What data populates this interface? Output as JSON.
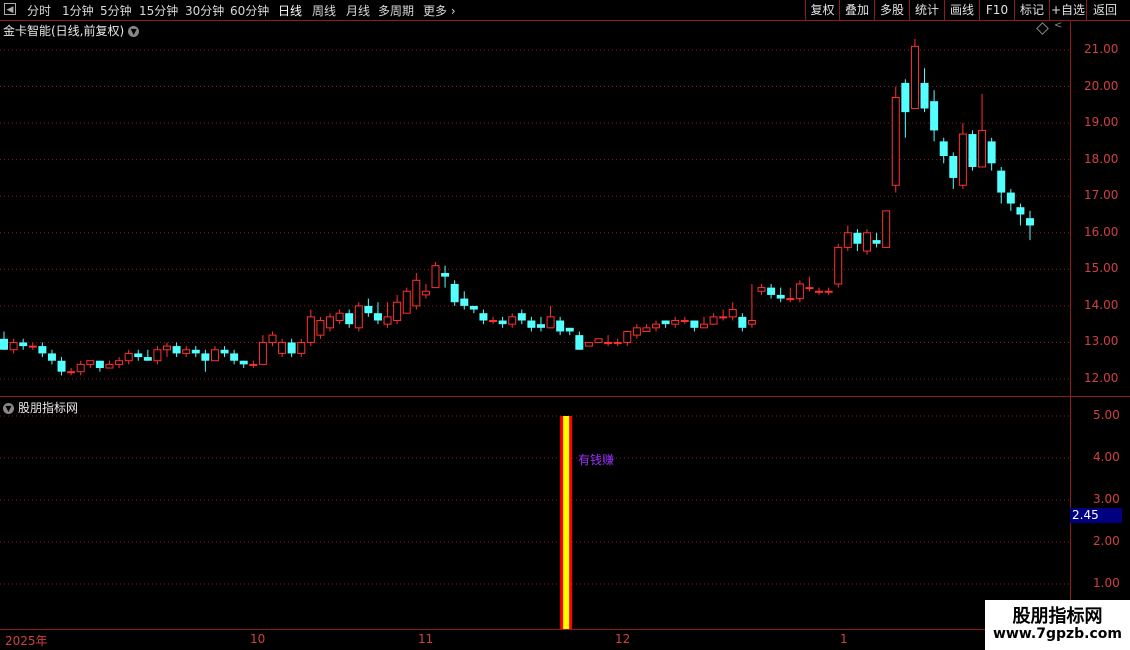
{
  "toolbar": {
    "tabs": [
      "分时",
      "1分钟",
      "5分钟",
      "15分钟",
      "30分钟",
      "60分钟",
      "日线",
      "周线",
      "月线",
      "多周期",
      "更多"
    ],
    "active": "日线",
    "right_buttons": [
      "复权",
      "叠加",
      "多股",
      "统计",
      "画线",
      "F10",
      "标记",
      "+自选",
      "返回"
    ]
  },
  "main_chart": {
    "title": "金卡智能(日线,前复权)",
    "price_labels": [
      "21.00",
      "20.00",
      "19.00",
      "18.00",
      "17.00",
      "16.00",
      "15.00",
      "14.00",
      "13.00",
      "12.00"
    ]
  },
  "sub_chart": {
    "title": "股朋指标网",
    "labels": [
      "5.00",
      "4.00",
      "3.00",
      "2.00",
      "1.00"
    ],
    "current_value": "2.45",
    "signal_label": "有钱赚"
  },
  "date_axis": [
    "2025年",
    "10",
    "11",
    "12",
    "1"
  ],
  "watermark": {
    "line1": "股朋指标网",
    "line2": "www.7gpzb.com"
  },
  "colors": {
    "up": "#ff3030",
    "down": "#54ffff",
    "grid": "#8a1c1c",
    "signal_outer": "#ff0000",
    "signal_inner": "#ffff00"
  },
  "chart_data": {
    "type": "candlestick",
    "ylim": [
      11.7,
      21.5
    ],
    "candles": [
      [
        13.1,
        12.8,
        13.3,
        12.8
      ],
      [
        12.8,
        13.0,
        13.1,
        12.7
      ],
      [
        13.0,
        12.9,
        13.1,
        12.8
      ],
      [
        12.9,
        12.9,
        13.0,
        12.8
      ],
      [
        12.9,
        12.7,
        13.0,
        12.6
      ],
      [
        12.7,
        12.5,
        12.8,
        12.4
      ],
      [
        12.5,
        12.2,
        12.6,
        12.1
      ],
      [
        12.2,
        12.2,
        12.3,
        12.1
      ],
      [
        12.2,
        12.4,
        12.5,
        12.1
      ],
      [
        12.4,
        12.5,
        12.5,
        12.3
      ],
      [
        12.5,
        12.3,
        12.5,
        12.2
      ],
      [
        12.3,
        12.4,
        12.5,
        12.3
      ],
      [
        12.4,
        12.5,
        12.6,
        12.3
      ],
      [
        12.5,
        12.7,
        12.8,
        12.4
      ],
      [
        12.7,
        12.6,
        12.8,
        12.5
      ],
      [
        12.6,
        12.5,
        12.8,
        12.5
      ],
      [
        12.5,
        12.8,
        12.9,
        12.4
      ],
      [
        12.8,
        12.9,
        13.0,
        12.6
      ],
      [
        12.9,
        12.7,
        13.0,
        12.6
      ],
      [
        12.7,
        12.8,
        12.9,
        12.6
      ],
      [
        12.8,
        12.7,
        12.9,
        12.6
      ],
      [
        12.7,
        12.5,
        12.8,
        12.2
      ],
      [
        12.5,
        12.8,
        12.9,
        12.5
      ],
      [
        12.8,
        12.7,
        12.9,
        12.6
      ],
      [
        12.7,
        12.5,
        12.8,
        12.4
      ],
      [
        12.5,
        12.4,
        12.5,
        12.3
      ],
      [
        12.4,
        12.4,
        12.5,
        12.3
      ],
      [
        12.4,
        13.0,
        13.2,
        12.4
      ],
      [
        13.0,
        13.2,
        13.3,
        12.9
      ],
      [
        12.7,
        13.0,
        13.1,
        12.6
      ],
      [
        13.0,
        12.7,
        13.1,
        12.6
      ],
      [
        12.7,
        13.0,
        13.1,
        12.6
      ],
      [
        13.0,
        13.7,
        13.9,
        12.9
      ],
      [
        13.2,
        13.6,
        13.7,
        13.1
      ],
      [
        13.4,
        13.7,
        13.8,
        13.3
      ],
      [
        13.6,
        13.8,
        13.9,
        13.5
      ],
      [
        13.8,
        13.5,
        13.9,
        13.4
      ],
      [
        13.4,
        14.0,
        14.1,
        13.3
      ],
      [
        14.0,
        13.8,
        14.2,
        13.7
      ],
      [
        13.8,
        13.6,
        14.1,
        13.5
      ],
      [
        13.5,
        13.7,
        14.1,
        13.4
      ],
      [
        13.6,
        14.1,
        14.3,
        13.5
      ],
      [
        13.8,
        14.4,
        14.5,
        13.8
      ],
      [
        14.0,
        14.7,
        14.9,
        13.9
      ],
      [
        14.3,
        14.4,
        14.6,
        14.2
      ],
      [
        14.5,
        15.1,
        15.2,
        14.5
      ],
      [
        14.9,
        14.8,
        15.1,
        14.5
      ],
      [
        14.6,
        14.1,
        14.7,
        14.0
      ],
      [
        14.2,
        14.0,
        14.4,
        13.9
      ],
      [
        14.0,
        13.9,
        14.0,
        13.8
      ],
      [
        13.8,
        13.6,
        13.9,
        13.5
      ],
      [
        13.6,
        13.6,
        13.7,
        13.5
      ],
      [
        13.6,
        13.5,
        13.7,
        13.4
      ],
      [
        13.5,
        13.7,
        13.8,
        13.4
      ],
      [
        13.8,
        13.6,
        13.9,
        13.5
      ],
      [
        13.6,
        13.4,
        13.7,
        13.3
      ],
      [
        13.5,
        13.4,
        13.7,
        13.3
      ],
      [
        13.4,
        13.7,
        14.0,
        13.4
      ],
      [
        13.6,
        13.3,
        13.7,
        13.2
      ],
      [
        13.4,
        13.3,
        13.4,
        13.2
      ],
      [
        13.2,
        12.8,
        13.3,
        12.8
      ],
      [
        12.9,
        13.0,
        13.0,
        12.9
      ],
      [
        13.0,
        13.1,
        13.1,
        13.0
      ],
      [
        13.0,
        13.0,
        13.2,
        12.9
      ],
      [
        13.0,
        13.0,
        13.1,
        12.9
      ],
      [
        13.0,
        13.3,
        13.3,
        12.9
      ],
      [
        13.2,
        13.4,
        13.5,
        13.1
      ],
      [
        13.3,
        13.4,
        13.5,
        13.3
      ],
      [
        13.4,
        13.5,
        13.6,
        13.3
      ],
      [
        13.6,
        13.5,
        13.6,
        13.4
      ],
      [
        13.5,
        13.6,
        13.7,
        13.4
      ],
      [
        13.6,
        13.6,
        13.7,
        13.5
      ],
      [
        13.6,
        13.4,
        13.6,
        13.3
      ],
      [
        13.4,
        13.5,
        13.7,
        13.4
      ],
      [
        13.5,
        13.7,
        13.8,
        13.5
      ],
      [
        13.7,
        13.7,
        13.9,
        13.6
      ],
      [
        13.7,
        13.9,
        14.1,
        13.6
      ],
      [
        13.7,
        13.4,
        13.8,
        13.3
      ],
      [
        13.5,
        13.6,
        14.6,
        13.4
      ],
      [
        14.4,
        14.5,
        14.6,
        14.3
      ],
      [
        14.5,
        14.3,
        14.6,
        14.2
      ],
      [
        14.3,
        14.2,
        14.5,
        14.1
      ],
      [
        14.2,
        14.2,
        14.5,
        14.1
      ],
      [
        14.2,
        14.6,
        14.7,
        14.1
      ],
      [
        14.5,
        14.5,
        14.8,
        14.4
      ],
      [
        14.4,
        14.4,
        14.5,
        14.3
      ],
      [
        14.4,
        14.4,
        14.5,
        14.3
      ],
      [
        14.6,
        15.6,
        15.7,
        14.5
      ],
      [
        15.6,
        16.0,
        16.2,
        15.5
      ],
      [
        16.0,
        15.7,
        16.1,
        15.5
      ],
      [
        15.5,
        16.0,
        16.1,
        15.4
      ],
      [
        15.8,
        15.7,
        16.0,
        15.6
      ],
      [
        15.6,
        16.6,
        16.6,
        15.6
      ],
      [
        17.3,
        19.7,
        20.0,
        17.1
      ],
      [
        20.1,
        19.3,
        20.2,
        18.6
      ],
      [
        19.4,
        21.1,
        21.3,
        19.4
      ],
      [
        20.1,
        19.4,
        20.5,
        19.3
      ],
      [
        19.6,
        18.8,
        19.9,
        18.5
      ],
      [
        18.5,
        18.1,
        18.6,
        17.9
      ],
      [
        18.1,
        17.5,
        18.2,
        17.2
      ],
      [
        17.3,
        18.7,
        19.0,
        17.2
      ],
      [
        18.7,
        17.8,
        18.8,
        17.7
      ],
      [
        17.8,
        18.8,
        19.8,
        17.8
      ],
      [
        18.5,
        17.9,
        18.6,
        17.7
      ],
      [
        17.7,
        17.1,
        17.8,
        16.8
      ],
      [
        17.1,
        16.8,
        17.2,
        16.6
      ],
      [
        16.7,
        16.5,
        16.8,
        16.2
      ],
      [
        16.4,
        16.2,
        16.6,
        15.8
      ]
    ],
    "signal_bar": {
      "index": 58,
      "value": 5.0
    },
    "sub_ylim": [
      0.55,
      5.3
    ]
  }
}
